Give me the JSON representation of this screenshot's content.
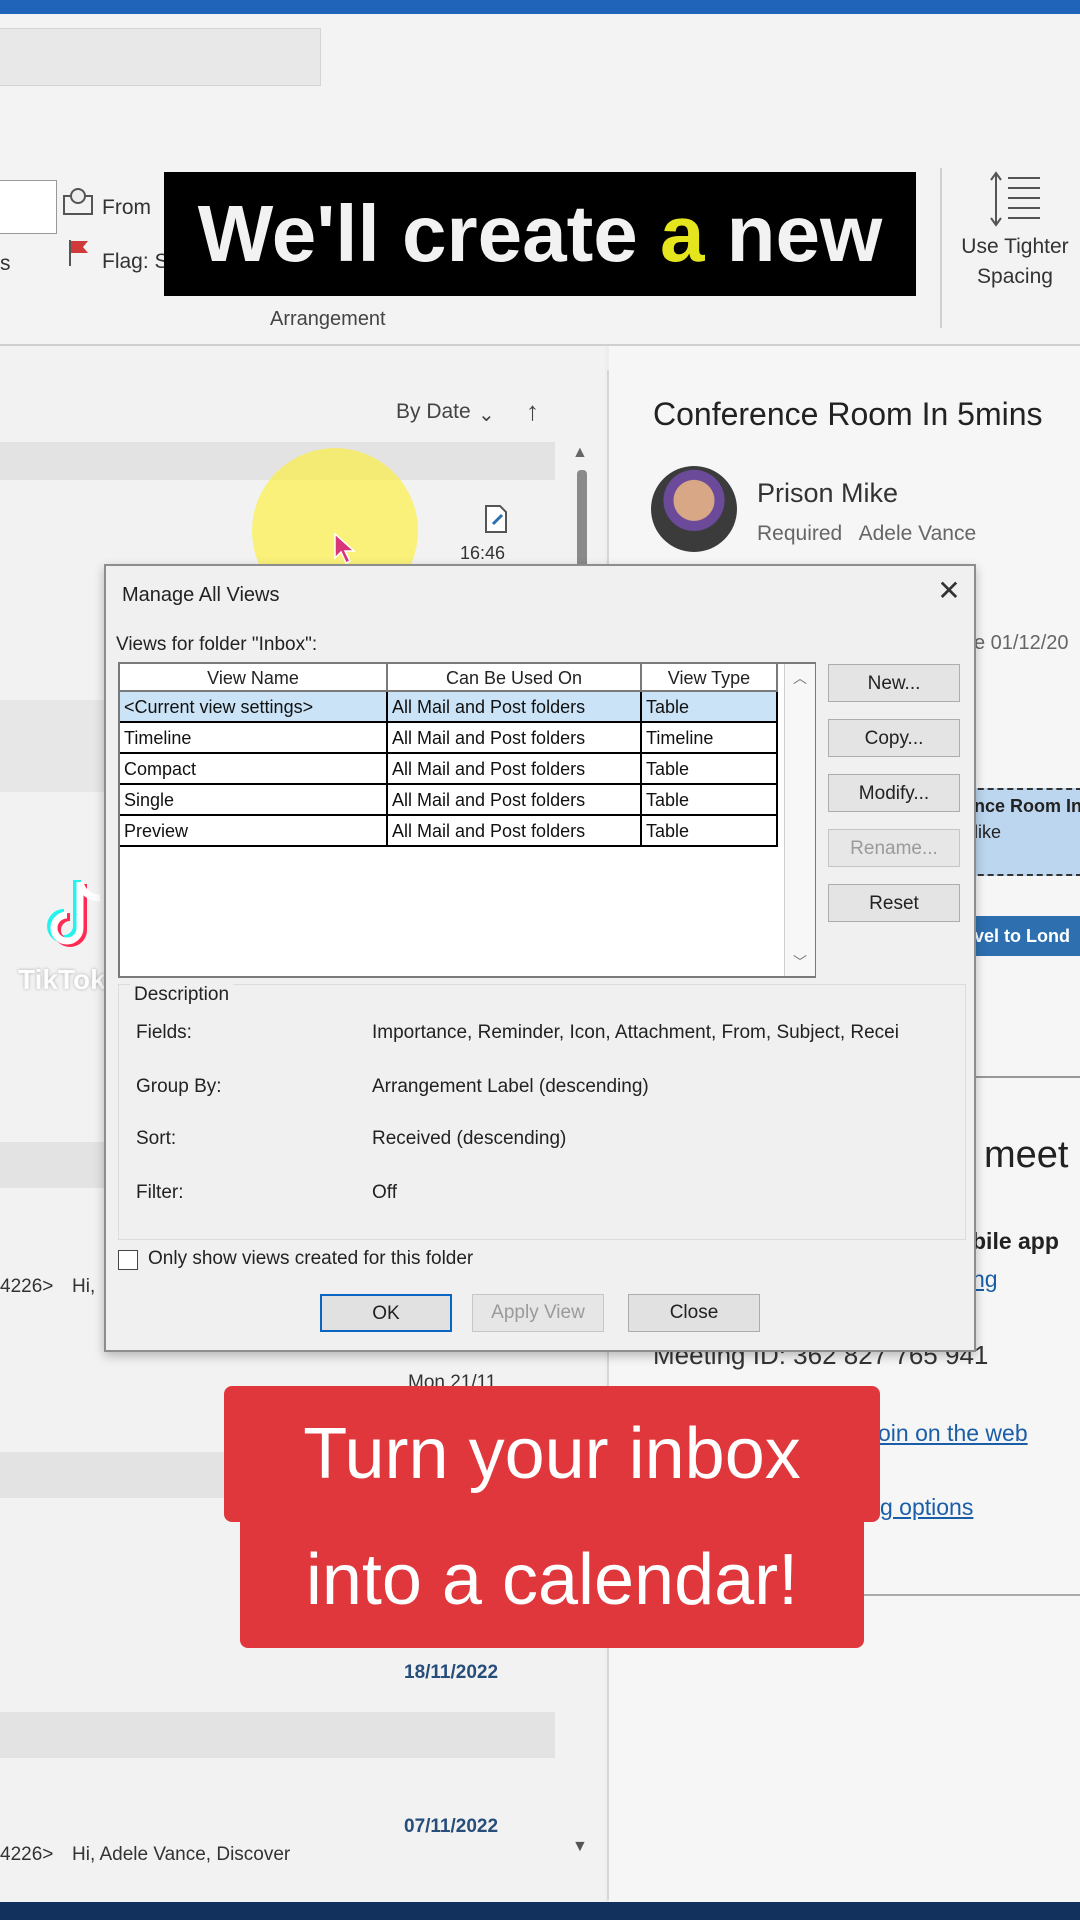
{
  "ribbon": {
    "from_label": "From",
    "flag_label": "Flag: S",
    "partial_left": "s",
    "arrangement_label": "Arrangement",
    "tighter_spacing_label": "Use Tighter Spacing"
  },
  "message_list": {
    "sort_label": "By Date",
    "row_time": "16:46",
    "row_snippet_1_sender": "4226>",
    "row_snippet_1_text": "Hi,",
    "date_partial": "Mon 21/11",
    "date_1": "18/11/2022",
    "date_2": "07/11/2022",
    "row_snippet_2_sender": "4226>",
    "row_snippet_2_text": "Hi, Adele Vance,  Discover"
  },
  "reading_pane": {
    "subject": "Conference Room In 5mins",
    "sender": "Prison Mike",
    "required_label": "Required",
    "attendee": "Adele Vance",
    "reply_date": "ve 01/12/20",
    "event_card_title": "nce Room In",
    "event_card_sub": "like",
    "travel_bar": "vel to Lond",
    "meet_text": "meet",
    "mobile_app": "bile app",
    "mobile_link": "ng",
    "meeting_id": "Meeting ID: 362 827 765 941",
    "join_web": "oin on the web",
    "meeting_options": "g options"
  },
  "watermark": {
    "brand": "TikTok"
  },
  "dialog": {
    "title": "Manage All Views",
    "close_glyph": "✕",
    "views_label": "Views for folder \"Inbox\":",
    "columns": [
      "View Name",
      "Can Be Used On",
      "View Type"
    ],
    "rows": [
      {
        "name": "<Current view settings>",
        "used_on": "All Mail and Post folders",
        "type": "Table",
        "selected": true
      },
      {
        "name": "Timeline",
        "used_on": "All Mail and Post folders",
        "type": "Timeline",
        "selected": false
      },
      {
        "name": "Compact",
        "used_on": "All Mail and Post folders",
        "type": "Table",
        "selected": false
      },
      {
        "name": "Single",
        "used_on": "All Mail and Post folders",
        "type": "Table",
        "selected": false
      },
      {
        "name": "Preview",
        "used_on": "All Mail and Post folders",
        "type": "Table",
        "selected": false
      }
    ],
    "buttons": {
      "new": "New...",
      "copy": "Copy...",
      "modify": "Modify...",
      "rename": "Rename...",
      "reset": "Reset",
      "ok": "OK",
      "apply": "Apply View",
      "close": "Close"
    },
    "description": {
      "title": "Description",
      "fields_key": "Fields:",
      "fields_val": "Importance, Reminder, Icon, Attachment, From, Subject, Recei",
      "group_key": "Group By:",
      "group_val": "Arrangement Label (descending)",
      "sort_key": "Sort:",
      "sort_val": "Received (descending)",
      "filter_key": "Filter:",
      "filter_val": "Off"
    },
    "only_show_label": "Only show views created for this folder"
  },
  "captions": {
    "top_prefix": "We'll create ",
    "top_highlight": "a",
    "top_suffix": " new",
    "bottom_line_1": "Turn your inbox",
    "bottom_line_2": "into a calendar!"
  },
  "colors": {
    "caption_red": "#e0373c",
    "caption_highlight": "#e5e51d",
    "selection_blue": "#cbe3f7",
    "cursor_glow": "#fff032"
  }
}
